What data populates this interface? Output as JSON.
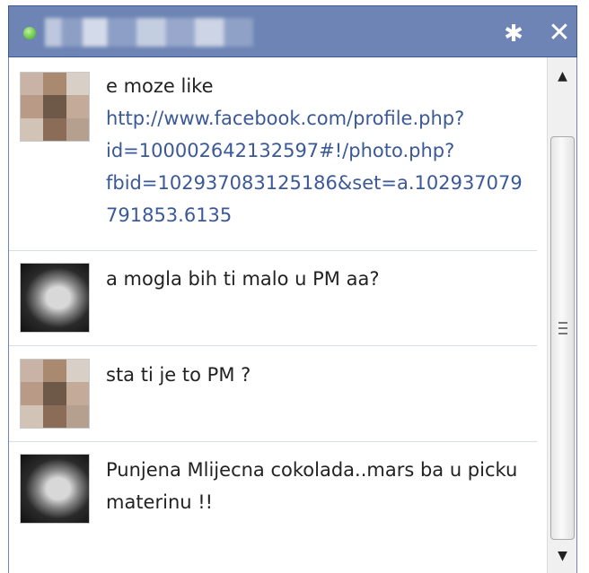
{
  "chat": {
    "online_color": "#5fbf3a",
    "header_color": "#6d84b4",
    "icons": {
      "settings": "gear-icon",
      "close": "close-icon"
    },
    "gear_glyph": "✱",
    "close_glyph": "✕"
  },
  "messages": [
    {
      "avatar": "pixelated-avatar",
      "text": "e moze like",
      "link": "http://www.facebook.com/profile.php?id=100002642132597#!/photo.php?fbid=102937083125186&set=a.102937079791853.6135"
    },
    {
      "avatar": "photo-avatar",
      "text": "a mogla bih ti malo u PM aa?"
    },
    {
      "avatar": "pixelated-avatar",
      "text": "sta ti je to PM ?"
    },
    {
      "avatar": "photo-avatar",
      "text": "Punjena Mlijecna cokolada..mars ba u picku materinu !!"
    }
  ],
  "scrollbar": {
    "up_glyph": "▲",
    "down_glyph": "▼",
    "position": 0.78
  }
}
